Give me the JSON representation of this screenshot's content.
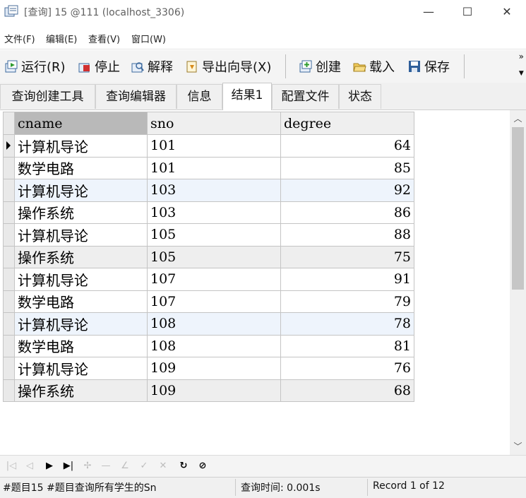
{
  "window": {
    "title": "[查询] 15 @111 (localhost_3306)",
    "minimize_glyph": "—",
    "maximize_glyph": "☐",
    "close_glyph": "✕"
  },
  "menu": [
    {
      "label": "文件(F)"
    },
    {
      "label": "编辑(E)"
    },
    {
      "label": "查看(V)"
    },
    {
      "label": "窗口(W)"
    }
  ],
  "toolbar": {
    "run": "运行(R)",
    "stop": "停止",
    "explain": "解释",
    "export": "导出向导(X)",
    "create": "创建",
    "load": "载入",
    "save": "保存",
    "more_glyph": "»"
  },
  "tabs": [
    {
      "label": "查询创建工具"
    },
    {
      "label": "查询编辑器"
    },
    {
      "label": "信息"
    },
    {
      "label": "结果1"
    },
    {
      "label": "配置文件"
    },
    {
      "label": "状态"
    }
  ],
  "active_tab_index": 3,
  "grid": {
    "columns": [
      "cname",
      "sno",
      "degree"
    ],
    "rows": [
      {
        "cname": "计算机导论",
        "sno": "101",
        "degree": "64"
      },
      {
        "cname": "数学电路",
        "sno": "101",
        "degree": "85"
      },
      {
        "cname": "计算机导论",
        "sno": "103",
        "degree": "92"
      },
      {
        "cname": "操作系统",
        "sno": "103",
        "degree": "86"
      },
      {
        "cname": "计算机导论",
        "sno": "105",
        "degree": "88"
      },
      {
        "cname": "操作系统",
        "sno": "105",
        "degree": "75"
      },
      {
        "cname": "计算机导论",
        "sno": "107",
        "degree": "91"
      },
      {
        "cname": "数学电路",
        "sno": "107",
        "degree": "79"
      },
      {
        "cname": "计算机导论",
        "sno": "108",
        "degree": "78"
      },
      {
        "cname": "数学电路",
        "sno": "108",
        "degree": "81"
      },
      {
        "cname": "计算机导论",
        "sno": "109",
        "degree": "76"
      },
      {
        "cname": "操作系统",
        "sno": "109",
        "degree": "68"
      }
    ]
  },
  "status": {
    "sql": "#题目15 #题目查询所有学生的Sn",
    "query_time": "查询时间: 0.001s",
    "record": "Record 1 of 12"
  },
  "colors": {
    "highlight_row": "#eef4fc",
    "gray_row": "#eeeeee",
    "header_selected": "#b9b9b9"
  }
}
